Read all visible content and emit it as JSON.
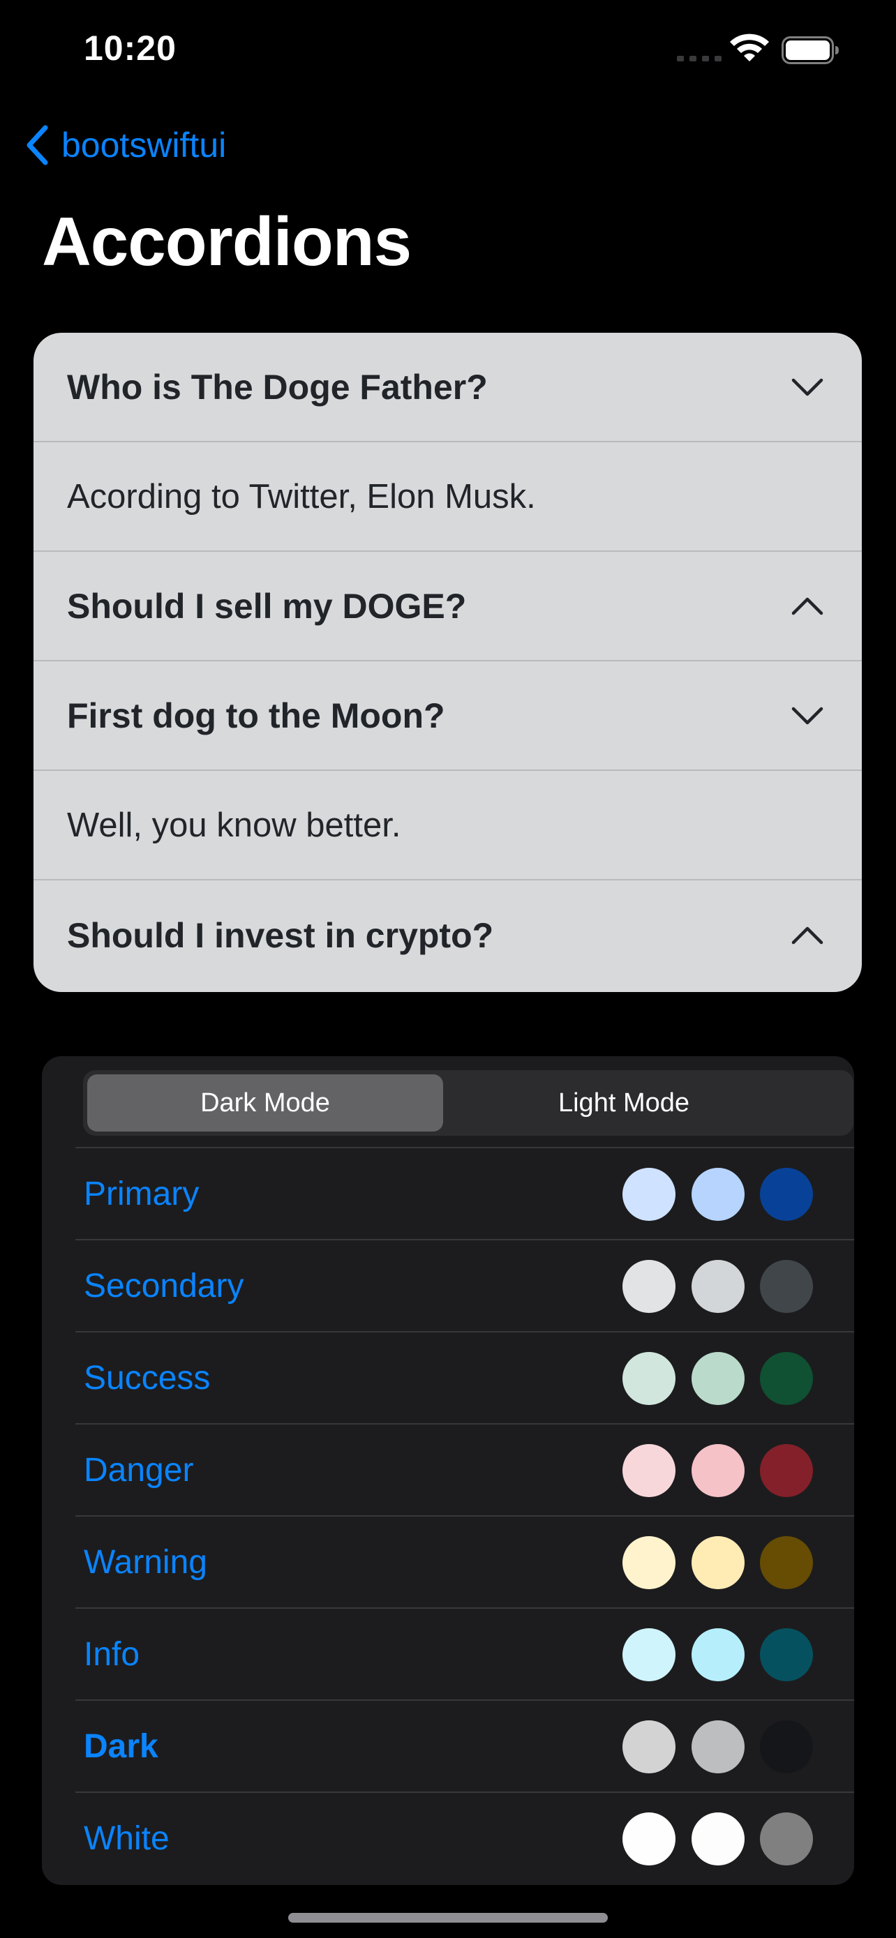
{
  "status_bar": {
    "time": "10:20",
    "icons": [
      "signal-icon",
      "wifi-icon",
      "battery-icon"
    ]
  },
  "nav": {
    "back_label": "bootswiftui",
    "back_icon": "chevron-left-icon",
    "title": "Accordions"
  },
  "accordion": {
    "items": [
      {
        "question": "Who is The Doge Father?",
        "expanded": true,
        "chevron": "chevron-down-icon",
        "answer": "Acording to Twitter, Elon Musk."
      },
      {
        "question": "Should I sell my DOGE?",
        "expanded": false,
        "chevron": "chevron-up-icon"
      },
      {
        "question": "First dog to the Moon?",
        "expanded": true,
        "chevron": "chevron-down-icon",
        "answer": "Well, you know better."
      },
      {
        "question": "Should I invest in crypto?",
        "expanded": false,
        "chevron": "chevron-up-icon"
      }
    ]
  },
  "mode_picker": {
    "options": [
      "Dark Mode",
      "Light Mode"
    ],
    "selected": "Dark Mode"
  },
  "colors": {
    "rows": [
      {
        "label": "Primary",
        "bold": false,
        "swatches": [
          "#cfe2ff",
          "#b6d4fe",
          "#084298"
        ]
      },
      {
        "label": "Secondary",
        "bold": false,
        "swatches": [
          "#e2e3e5",
          "#d3d6d8",
          "#41464b"
        ]
      },
      {
        "label": "Success",
        "bold": false,
        "swatches": [
          "#d1e7dd",
          "#badbcc",
          "#0f5132"
        ]
      },
      {
        "label": "Danger",
        "bold": false,
        "swatches": [
          "#f8d7da",
          "#f5c2c7",
          "#842029"
        ]
      },
      {
        "label": "Warning",
        "bold": false,
        "swatches": [
          "#fff3cd",
          "#ffecb5",
          "#664d03"
        ]
      },
      {
        "label": "Info",
        "bold": false,
        "swatches": [
          "#cff4fc",
          "#b6effb",
          "#055160"
        ]
      },
      {
        "label": "Dark",
        "bold": true,
        "swatches": [
          "#d3d3d4",
          "#bcbebf",
          "#141619"
        ]
      },
      {
        "label": "White",
        "bold": false,
        "swatches": [
          "#fefefe",
          "#fdfdfe",
          "#808080"
        ]
      }
    ]
  },
  "theme": {
    "accent": "#0a84ff",
    "background": "#000000",
    "accordion_bg": "#d8d9db",
    "card_bg": "#1c1c1e"
  }
}
